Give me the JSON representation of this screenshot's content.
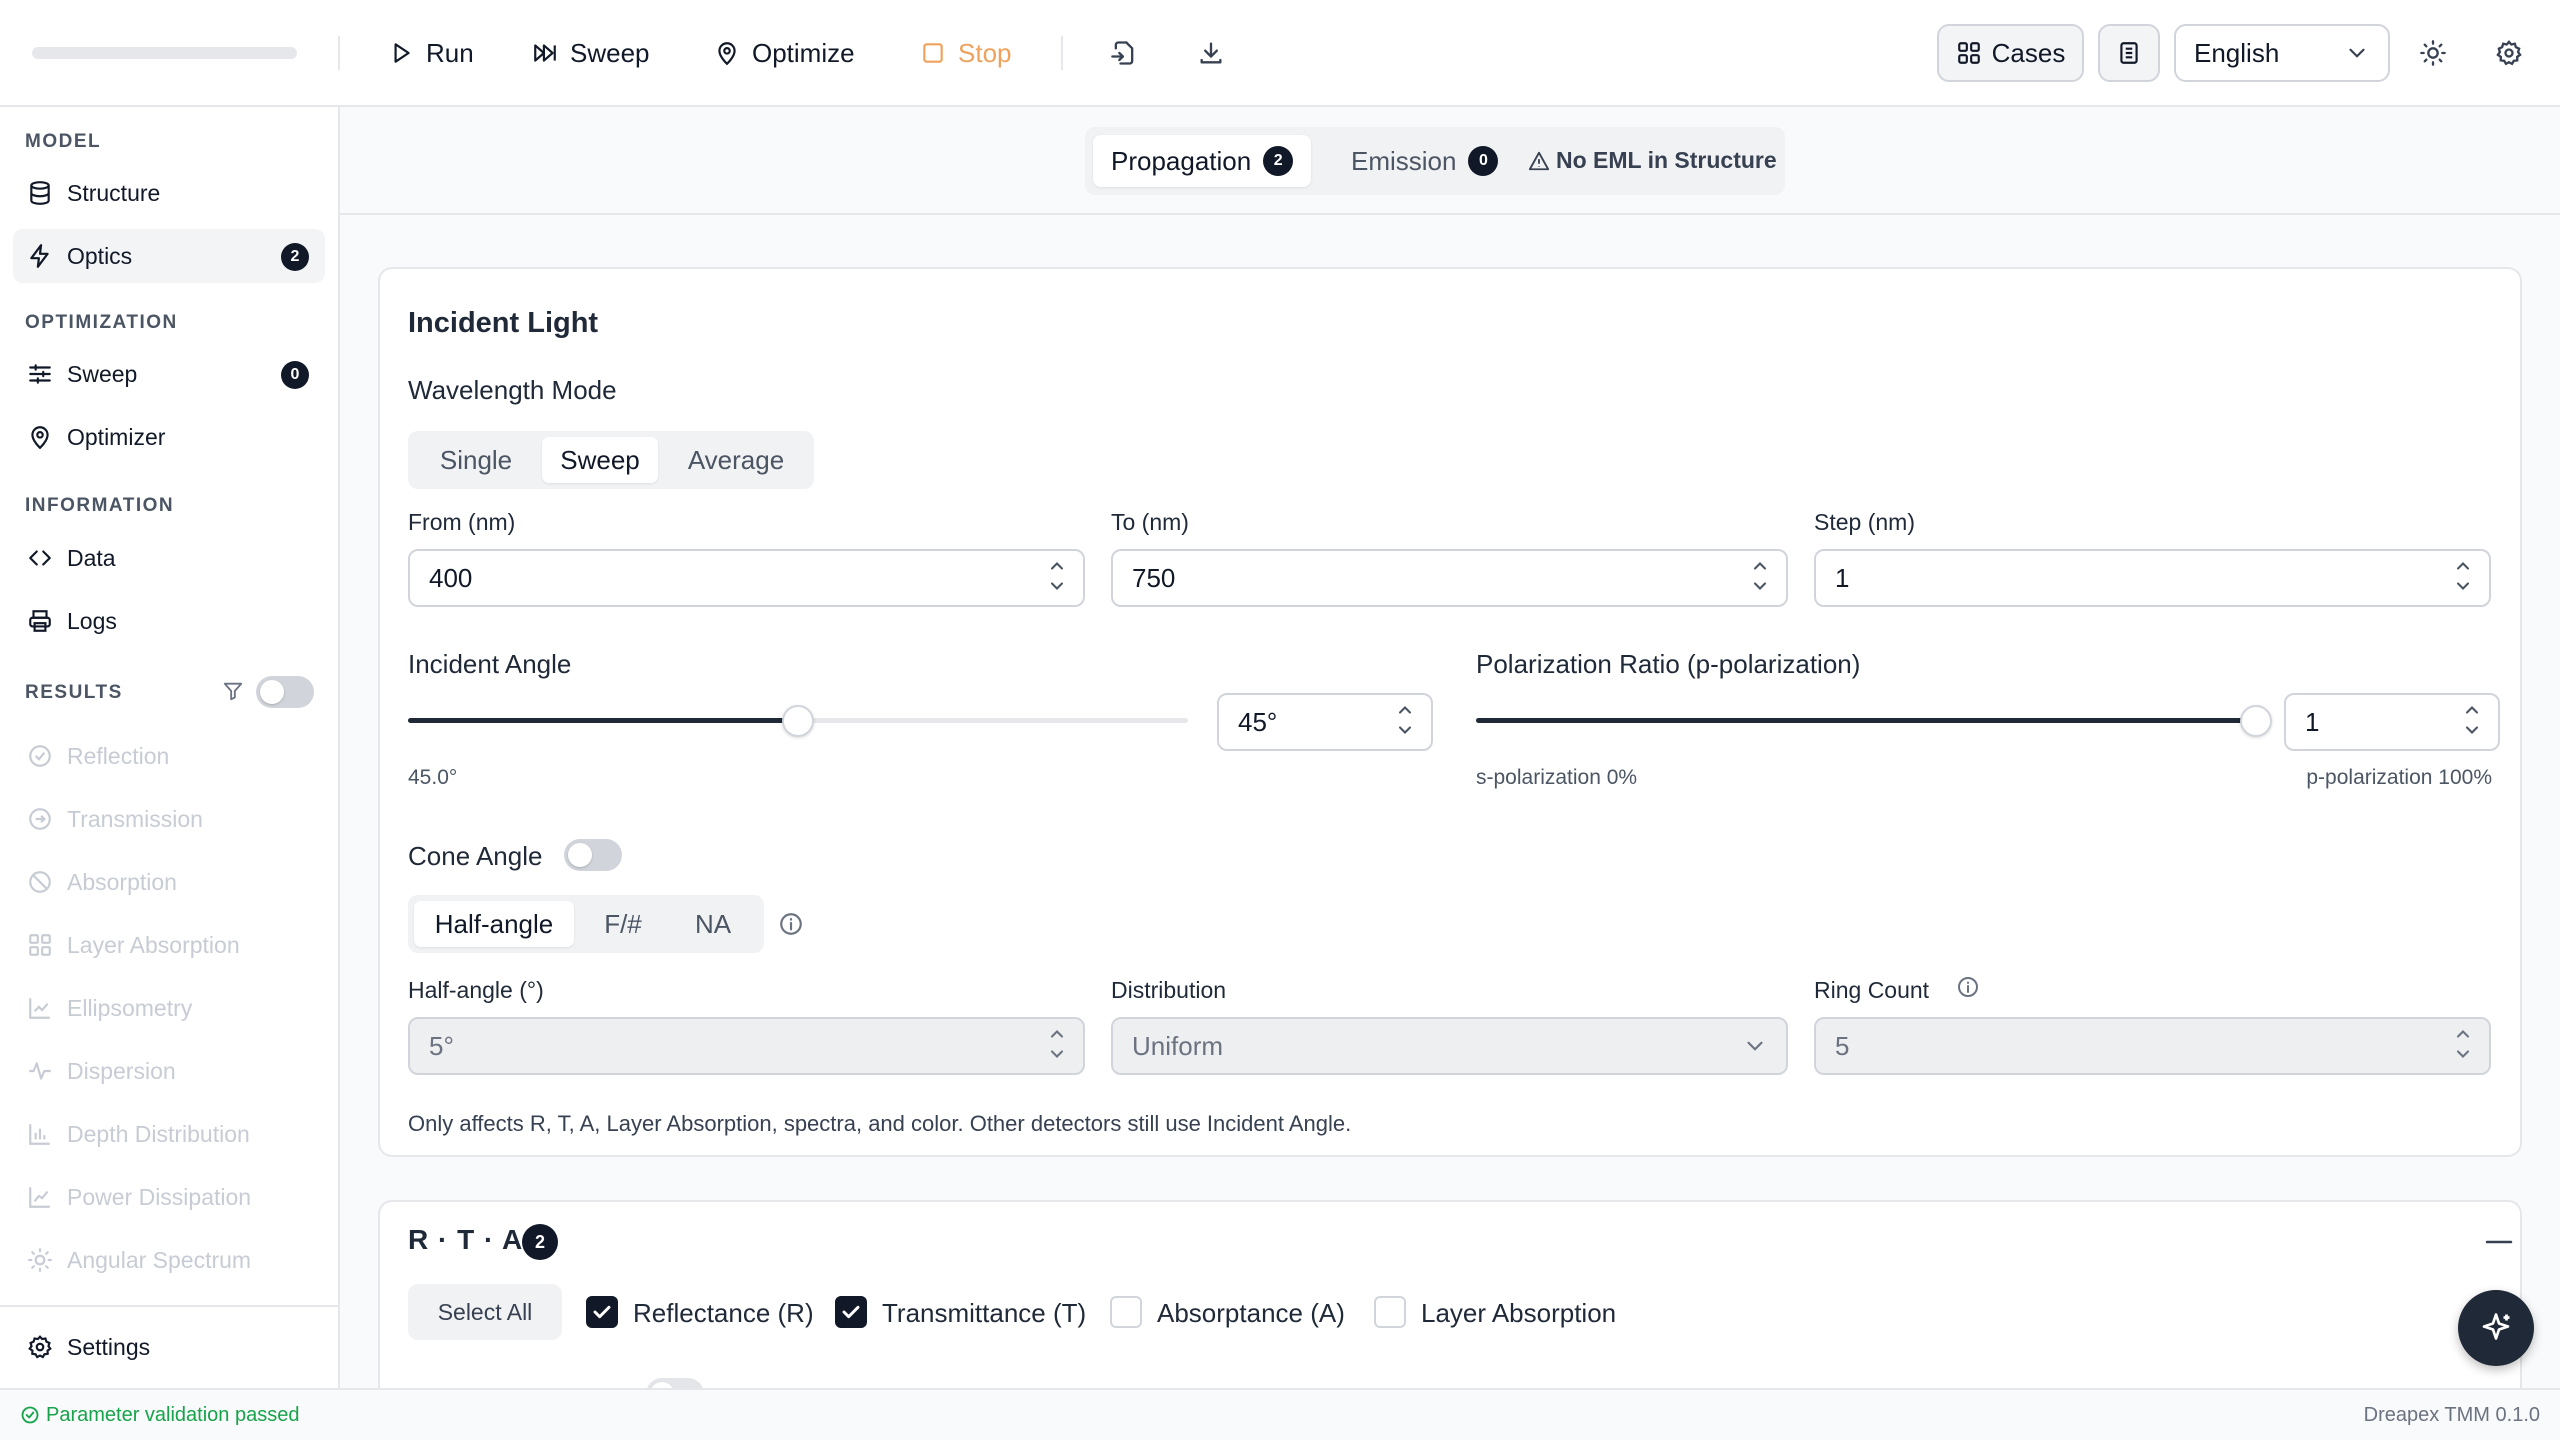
{
  "toolbar": {
    "run": "Run",
    "sweep": "Sweep",
    "optimize": "Optimize",
    "stop": "Stop",
    "cases": "Cases",
    "language": "English"
  },
  "sidebar": {
    "model_section": "MODEL",
    "structure": "Structure",
    "optics": "Optics",
    "optics_badge": "2",
    "optimization_section": "OPTIMIZATION",
    "sweep": "Sweep",
    "sweep_badge": "0",
    "optimizer": "Optimizer",
    "information_section": "INFORMATION",
    "data": "Data",
    "logs": "Logs",
    "results_section": "RESULTS",
    "results": [
      "Reflection",
      "Transmission",
      "Absorption",
      "Layer Absorption",
      "Ellipsometry",
      "Dispersion",
      "Depth Distribution",
      "Power Dissipation",
      "Angular Spectrum"
    ],
    "settings": "Settings"
  },
  "tabs": {
    "propagation": "Propagation",
    "propagation_badge": "2",
    "emission": "Emission",
    "emission_badge": "0",
    "warning": "No EML in Structure"
  },
  "incident": {
    "title": "Incident Light",
    "wavelength_mode_label": "Wavelength Mode",
    "modes": [
      "Single",
      "Sweep",
      "Average"
    ],
    "from_label": "From (nm)",
    "from_value": "400",
    "to_label": "To (nm)",
    "to_value": "750",
    "step_label": "Step (nm)",
    "step_value": "1",
    "angle_label": "Incident Angle",
    "angle_value": "45°",
    "angle_readout": "45.0°",
    "angle_fraction": 0.5,
    "pol_label": "Polarization Ratio (p-polarization)",
    "pol_value": "1",
    "pol_fraction": 1.0,
    "pol_min": "s-polarization 0%",
    "pol_max": "p-polarization 100%",
    "cone_label": "Cone Angle",
    "cone_modes": [
      "Half-angle",
      "F/#",
      "NA"
    ],
    "half_angle_label": "Half-angle (°)",
    "half_angle_value": "5°",
    "distribution_label": "Distribution",
    "distribution_value": "Uniform",
    "ring_label": "Ring Count",
    "ring_value": "5",
    "note": "Only affects R, T, A, Layer Absorption, spectra, and color. Other detectors still use Incident Angle."
  },
  "rta": {
    "title": "R · T · A",
    "badge": "2",
    "select_all": "Select All",
    "reflectance": "Reflectance (R)",
    "transmittance": "Transmittance (T)",
    "absorptance": "Absorptance (A)",
    "layer_absorption": "Layer Absorption"
  },
  "status": {
    "message": "Parameter validation passed",
    "version": "Dreapex TMM 0.1.0"
  },
  "colors": {
    "accent": "#111827",
    "stop": "#f0a25c",
    "success": "#16a34a"
  }
}
